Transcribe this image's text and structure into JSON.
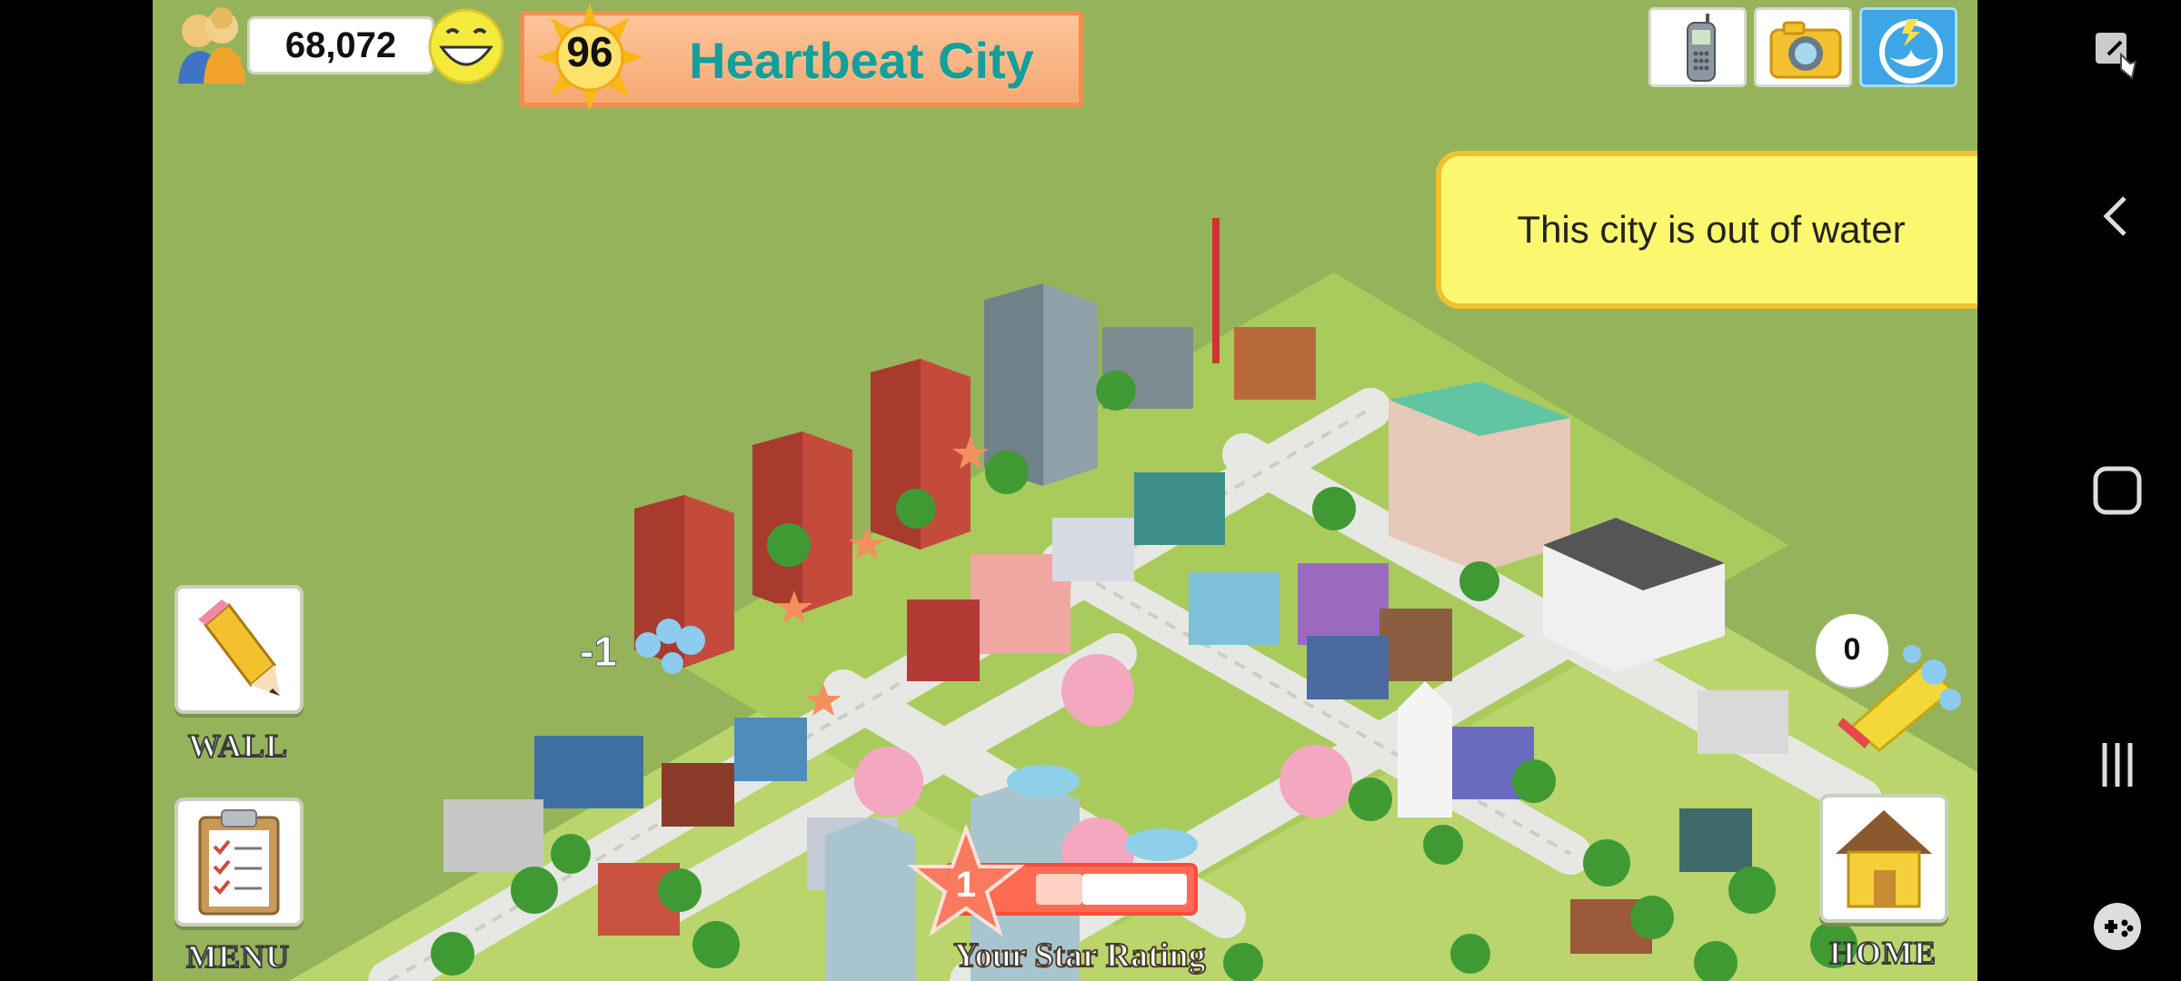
{
  "hud": {
    "population": "68,072",
    "level": "96",
    "city_name": "Heartbeat City"
  },
  "notice": {
    "text": "This city is out of water"
  },
  "buttons": {
    "wall_label": "WALL",
    "menu_label": "MENU",
    "home_label": "HOME",
    "phone_icon": "phone-icon",
    "camera_icon": "camera-icon",
    "share_icon": "share-icon"
  },
  "badge": {
    "count": "0"
  },
  "star_rating": {
    "level": "1",
    "progress": 0.55,
    "label": "Your Star Rating"
  },
  "map_floating_text": "-1",
  "colors": {
    "grass": "#95b35a",
    "banner": "#f7a872",
    "title": "#139f9a",
    "notice_bg": "#fbf870",
    "rating_bar": "#ff6a55"
  }
}
